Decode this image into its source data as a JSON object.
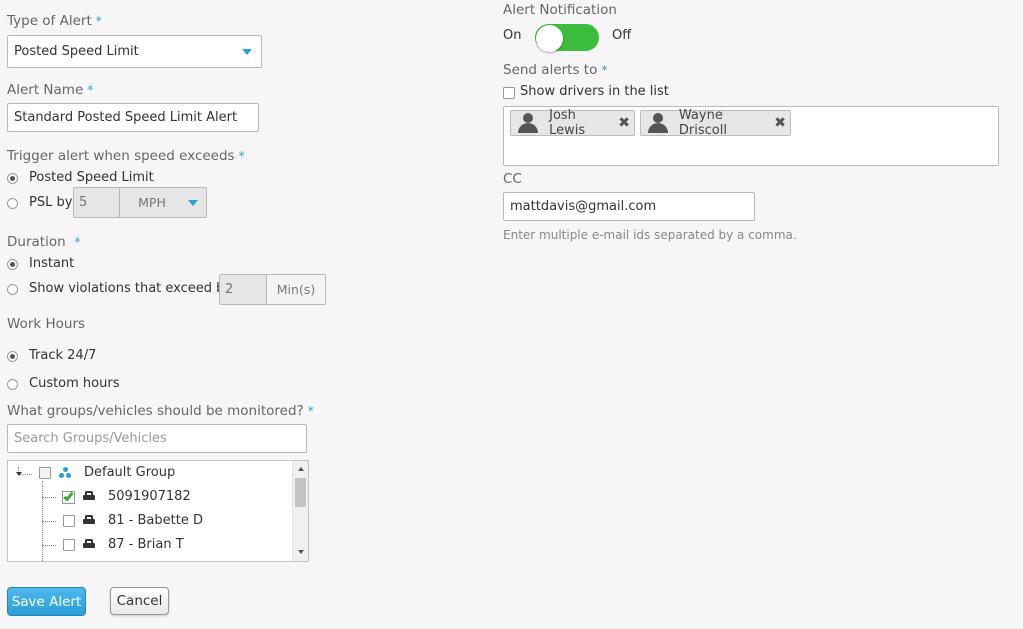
{
  "type_of_alert": {
    "label": "Type of Alert",
    "required_mark": "*",
    "selected": "Posted Speed Limit"
  },
  "alert_name": {
    "label": "Alert Name",
    "required_mark": "*",
    "value": "Standard Posted Speed Limit Alert"
  },
  "trigger": {
    "label": "Trigger alert when speed exceeds",
    "required_mark": "*",
    "options": [
      {
        "label": "Posted Speed Limit",
        "selected": true
      },
      {
        "label": "PSL by",
        "selected": false
      }
    ],
    "psl_value": "5",
    "psl_unit": "MPH"
  },
  "duration": {
    "label": "Duration",
    "required_mark": "*",
    "options": [
      {
        "label": "Instant",
        "selected": true
      },
      {
        "label": "Show violations that exceed by",
        "selected": false
      }
    ],
    "exceed_value": "2",
    "exceed_unit": "Min(s)"
  },
  "work_hours": {
    "label": "Work Hours",
    "options": [
      {
        "label": "Track 24/7",
        "selected": true
      },
      {
        "label": "Custom hours",
        "selected": false
      }
    ]
  },
  "groups": {
    "label": "What groups/vehicles should be monitored?",
    "required_mark": "*",
    "search_placeholder": "Search Groups/Vehicles",
    "tree": {
      "group_name": "Default Group",
      "vehicles": [
        {
          "label": "5091907182",
          "checked": true
        },
        {
          "label": "81 - Babette D",
          "checked": false
        },
        {
          "label": "87 - Brian T",
          "checked": false
        }
      ]
    }
  },
  "notification": {
    "label": "Alert Notification",
    "on_label": "On",
    "off_label": "Off",
    "enabled": true
  },
  "send_to": {
    "label": "Send alerts to",
    "required_mark": "*",
    "show_drivers_label": "Show drivers in the list",
    "recipients": [
      "Josh Lewis",
      "Wayne Driscoll"
    ],
    "remove_glyph": "✖"
  },
  "cc": {
    "label": "CC",
    "value": "mattdavis@gmail.com",
    "hint": "Enter multiple e-mail ids separated by a comma."
  },
  "actions": {
    "save_label": "Save Alert",
    "cancel_label": "Cancel"
  },
  "colors": {
    "accent": "#2a9fd6",
    "toggle_on": "#3dbd3d",
    "check_green": "#3aa53a"
  }
}
